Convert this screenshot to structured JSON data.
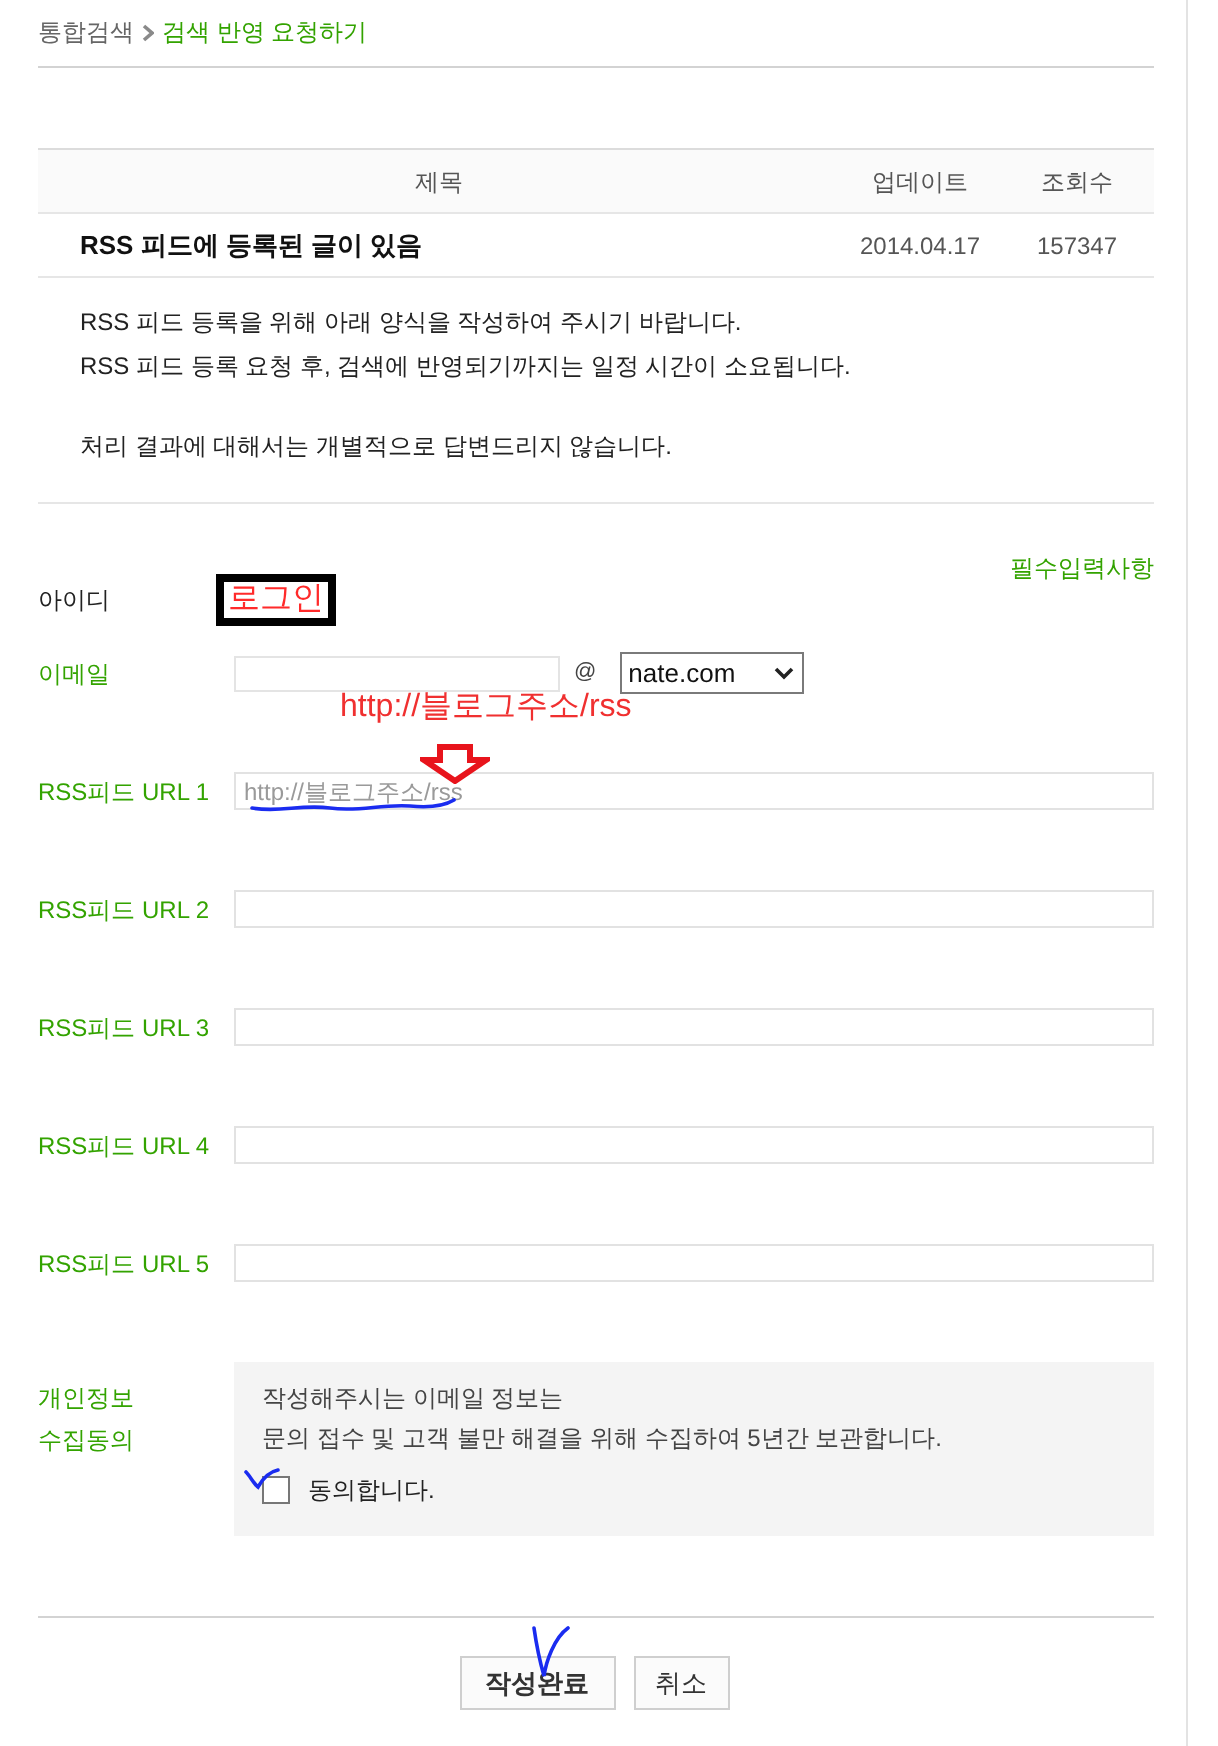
{
  "breadcrumb": [
    {
      "label": "통합검색",
      "current": false
    },
    {
      "label": "검색 반영 요청하기",
      "current": true
    }
  ],
  "table": {
    "columns": [
      "제목",
      "업데이트",
      "조회수"
    ],
    "rows": [
      {
        "cells": [
          "RSS 피드에 등록된 글이 있음",
          "2014.04.17",
          "157347"
        ]
      }
    ]
  },
  "notice": [
    {
      "lines": [
        "RSS 피드 등록을 위해 아래 양식을 작성하여 주시기 바랍니다.",
        "RSS 피드 등록 요청 후, 검색에 반영되기까지는 일정 시간이 소요됩니다."
      ]
    },
    {
      "lines": [
        "처리 결과에 대해서는 개별적으로 답변드리지 않습니다."
      ]
    }
  ],
  "required_note": "필수입력사항",
  "form": {
    "fields": [
      {
        "kind": "login",
        "label": "아이디",
        "required": false,
        "link": "로그인",
        "highlighted": true
      },
      {
        "kind": "email",
        "label": "이메일",
        "required": true,
        "at": "@",
        "domain": "nate.com"
      },
      {
        "kind": "url",
        "label": "RSS피드 URL 1",
        "required": true,
        "placeholder": "http://블로그주소/rss",
        "note": "http://블로그주소/rss",
        "underlined": true
      },
      {
        "kind": "url",
        "label": "RSS피드 URL 2",
        "required": true,
        "underlined": false
      },
      {
        "kind": "url",
        "label": "RSS피드 URL 3",
        "required": true,
        "underlined": false
      },
      {
        "kind": "url",
        "label": "RSS피드 URL 4",
        "required": true,
        "underlined": false
      },
      {
        "kind": "url",
        "label": "RSS피드 URL 5",
        "required": true,
        "underlined": false
      }
    ]
  },
  "consent": {
    "label_lines": [
      "개인정보",
      "수집동의"
    ],
    "text_lines": [
      "작성해주시는 이메일 정보는",
      "문의 접수 및 고객 불만 해결을 위해 수집하여 5년간 보관합니다."
    ],
    "checkbox": {
      "label": "동의합니다.",
      "checked": false,
      "scribbled": true
    }
  },
  "buttons": [
    {
      "label": "작성완료",
      "primary": true,
      "scribbled": true
    },
    {
      "label": "취소",
      "primary": false,
      "scribbled": false
    }
  ]
}
